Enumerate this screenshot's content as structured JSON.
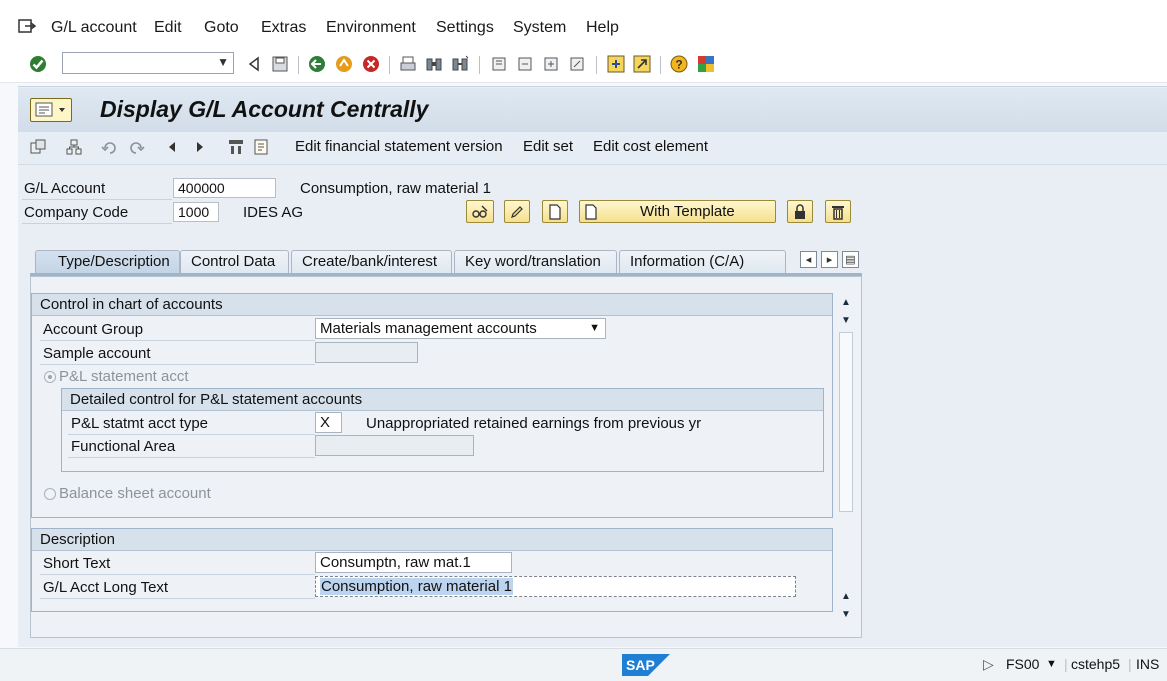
{
  "menu": {
    "items": [
      "G/L account",
      "Edit",
      "Goto",
      "Extras",
      "Environment",
      "Settings",
      "System",
      "Help"
    ]
  },
  "toolbar": {
    "command_field_value": "",
    "icons": [
      "enter-icon",
      "back-icon",
      "save-icon",
      "back-green-icon",
      "exit-icon",
      "cancel-icon",
      "print-icon",
      "find-icon",
      "find-next-icon",
      "first-page-icon",
      "prev-page-icon",
      "next-page-icon",
      "last-page-icon",
      "create-session-icon",
      "shortcut-icon",
      "help-icon",
      "customize-layout-icon"
    ]
  },
  "page": {
    "title": "Display G/L Account Centrally"
  },
  "app_toolbar": {
    "edit_fs_version": "Edit financial statement version",
    "edit_set": "Edit set",
    "edit_cost_element": "Edit cost element"
  },
  "header": {
    "gl_account_label": "G/L Account",
    "gl_account_value": "400000",
    "gl_account_desc": "Consumption, raw material 1",
    "company_code_label": "Company Code",
    "company_code_value": "1000",
    "company_name": "IDES AG",
    "with_template_label": "With Template"
  },
  "tabs": [
    {
      "label": "Type/Description",
      "active": true
    },
    {
      "label": "Control Data",
      "active": false
    },
    {
      "label": "Create/bank/interest",
      "active": false
    },
    {
      "label": "Key word/translation",
      "active": false
    },
    {
      "label": "Information (C/A)",
      "active": false
    }
  ],
  "control_group": {
    "title": "Control in chart of accounts",
    "account_group_label": "Account Group",
    "account_group_value": "Materials management accounts",
    "sample_account_label": "Sample account",
    "sample_account_value": "",
    "pl_radio_label": "P&L statement acct",
    "detail_title": "Detailed control for P&L statement accounts",
    "pl_type_label": "P&L statmt acct type",
    "pl_type_value": "X",
    "pl_type_desc": "Unappropriated retained earnings from previous yr",
    "functional_area_label": "Functional Area",
    "functional_area_value": "",
    "bs_radio_label": "Balance sheet account"
  },
  "description_group": {
    "title": "Description",
    "short_text_label": "Short Text",
    "short_text_value": "Consumptn, raw mat.1",
    "long_text_label": "G/L Acct Long Text",
    "long_text_value": "Consumption, raw material 1"
  },
  "status": {
    "logo": "SAP",
    "transaction": "FS00",
    "server": "cstehp5",
    "mode": "INS"
  },
  "colors": {
    "title_band": "#d2dde9",
    "button_yellow": "#f6e08d",
    "selection_blue": "#4a8fd6"
  }
}
